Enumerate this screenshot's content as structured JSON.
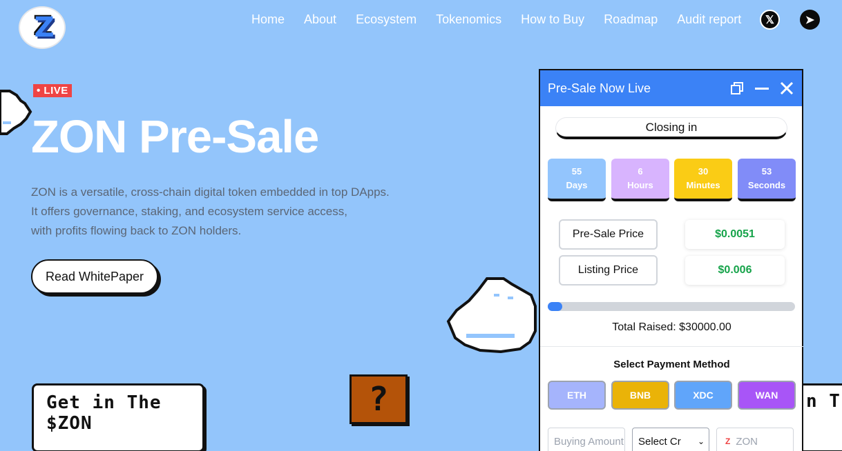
{
  "brand": {
    "logo_text": "Z"
  },
  "nav": {
    "items": [
      "Home",
      "About",
      "Ecosystem",
      "Tokenomics",
      "How to Buy",
      "Roadmap",
      "Audit report"
    ]
  },
  "social": {
    "x_label": "𝕏",
    "telegram_label": "➤"
  },
  "hero": {
    "badge": "• LIVE",
    "title": "ZON Pre-Sale",
    "desc_lines": [
      "ZON is a versatile, cross-chain digital token embedded in top DApps.",
      "It offers governance, staking, and ecosystem service access,",
      "with profits flowing back to ZON holders."
    ],
    "button": "Read WhitePaper"
  },
  "decor": {
    "bubble_lines": [
      "Get in The",
      "$ZON"
    ],
    "bubble2_text": "n T",
    "qblock": "?"
  },
  "widget": {
    "title": "Pre-Sale Now Live",
    "closing_label": "Closing in",
    "countdown": [
      {
        "value": "55",
        "unit": "Days",
        "color": "#93c5fd"
      },
      {
        "value": "6",
        "unit": "Hours",
        "color": "#d8b4fe"
      },
      {
        "value": "30",
        "unit": "Minutes",
        "color": "#facc15"
      },
      {
        "value": "53",
        "unit": "Seconds",
        "color": "#818cf8"
      }
    ],
    "presale_label": "Pre-Sale Price",
    "presale_value": "$0.0051",
    "listing_label": "Listing Price",
    "listing_value": "$0.006",
    "progress_fraction": 0.06,
    "raised_text": "Total Raised: $30000.00",
    "payment_title": "Select Payment Method",
    "payment_methods": [
      {
        "label": "ETH",
        "color": "#a5b4fc"
      },
      {
        "label": "BNB",
        "color": "#eab308"
      },
      {
        "label": "XDC",
        "color": "#60a5fa"
      },
      {
        "label": "WAN",
        "color": "#a855f7"
      }
    ],
    "amount_placeholder": "Buying Amount",
    "select_currency": "Select Cr",
    "zon_placeholder": "ZON"
  }
}
